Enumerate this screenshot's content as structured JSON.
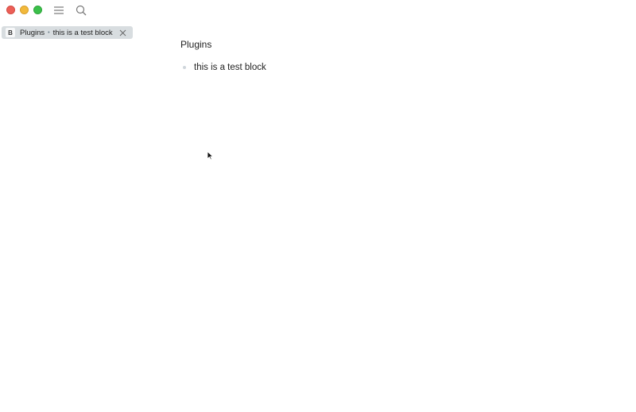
{
  "tab": {
    "badge": "B",
    "page": "Plugins",
    "separator": "•",
    "block": "this is a test block"
  },
  "page": {
    "title": "Plugins",
    "blocks": [
      {
        "text": "this is a test block"
      }
    ]
  },
  "icons": {
    "menu": "hamburger-menu-icon",
    "search": "search-icon",
    "close": "close-icon"
  },
  "colors": {
    "close_light": "#ec5f57",
    "minimize_light": "#f2b93b",
    "maximize_light": "#3bc04a",
    "tab_background": "#d8dde0"
  }
}
